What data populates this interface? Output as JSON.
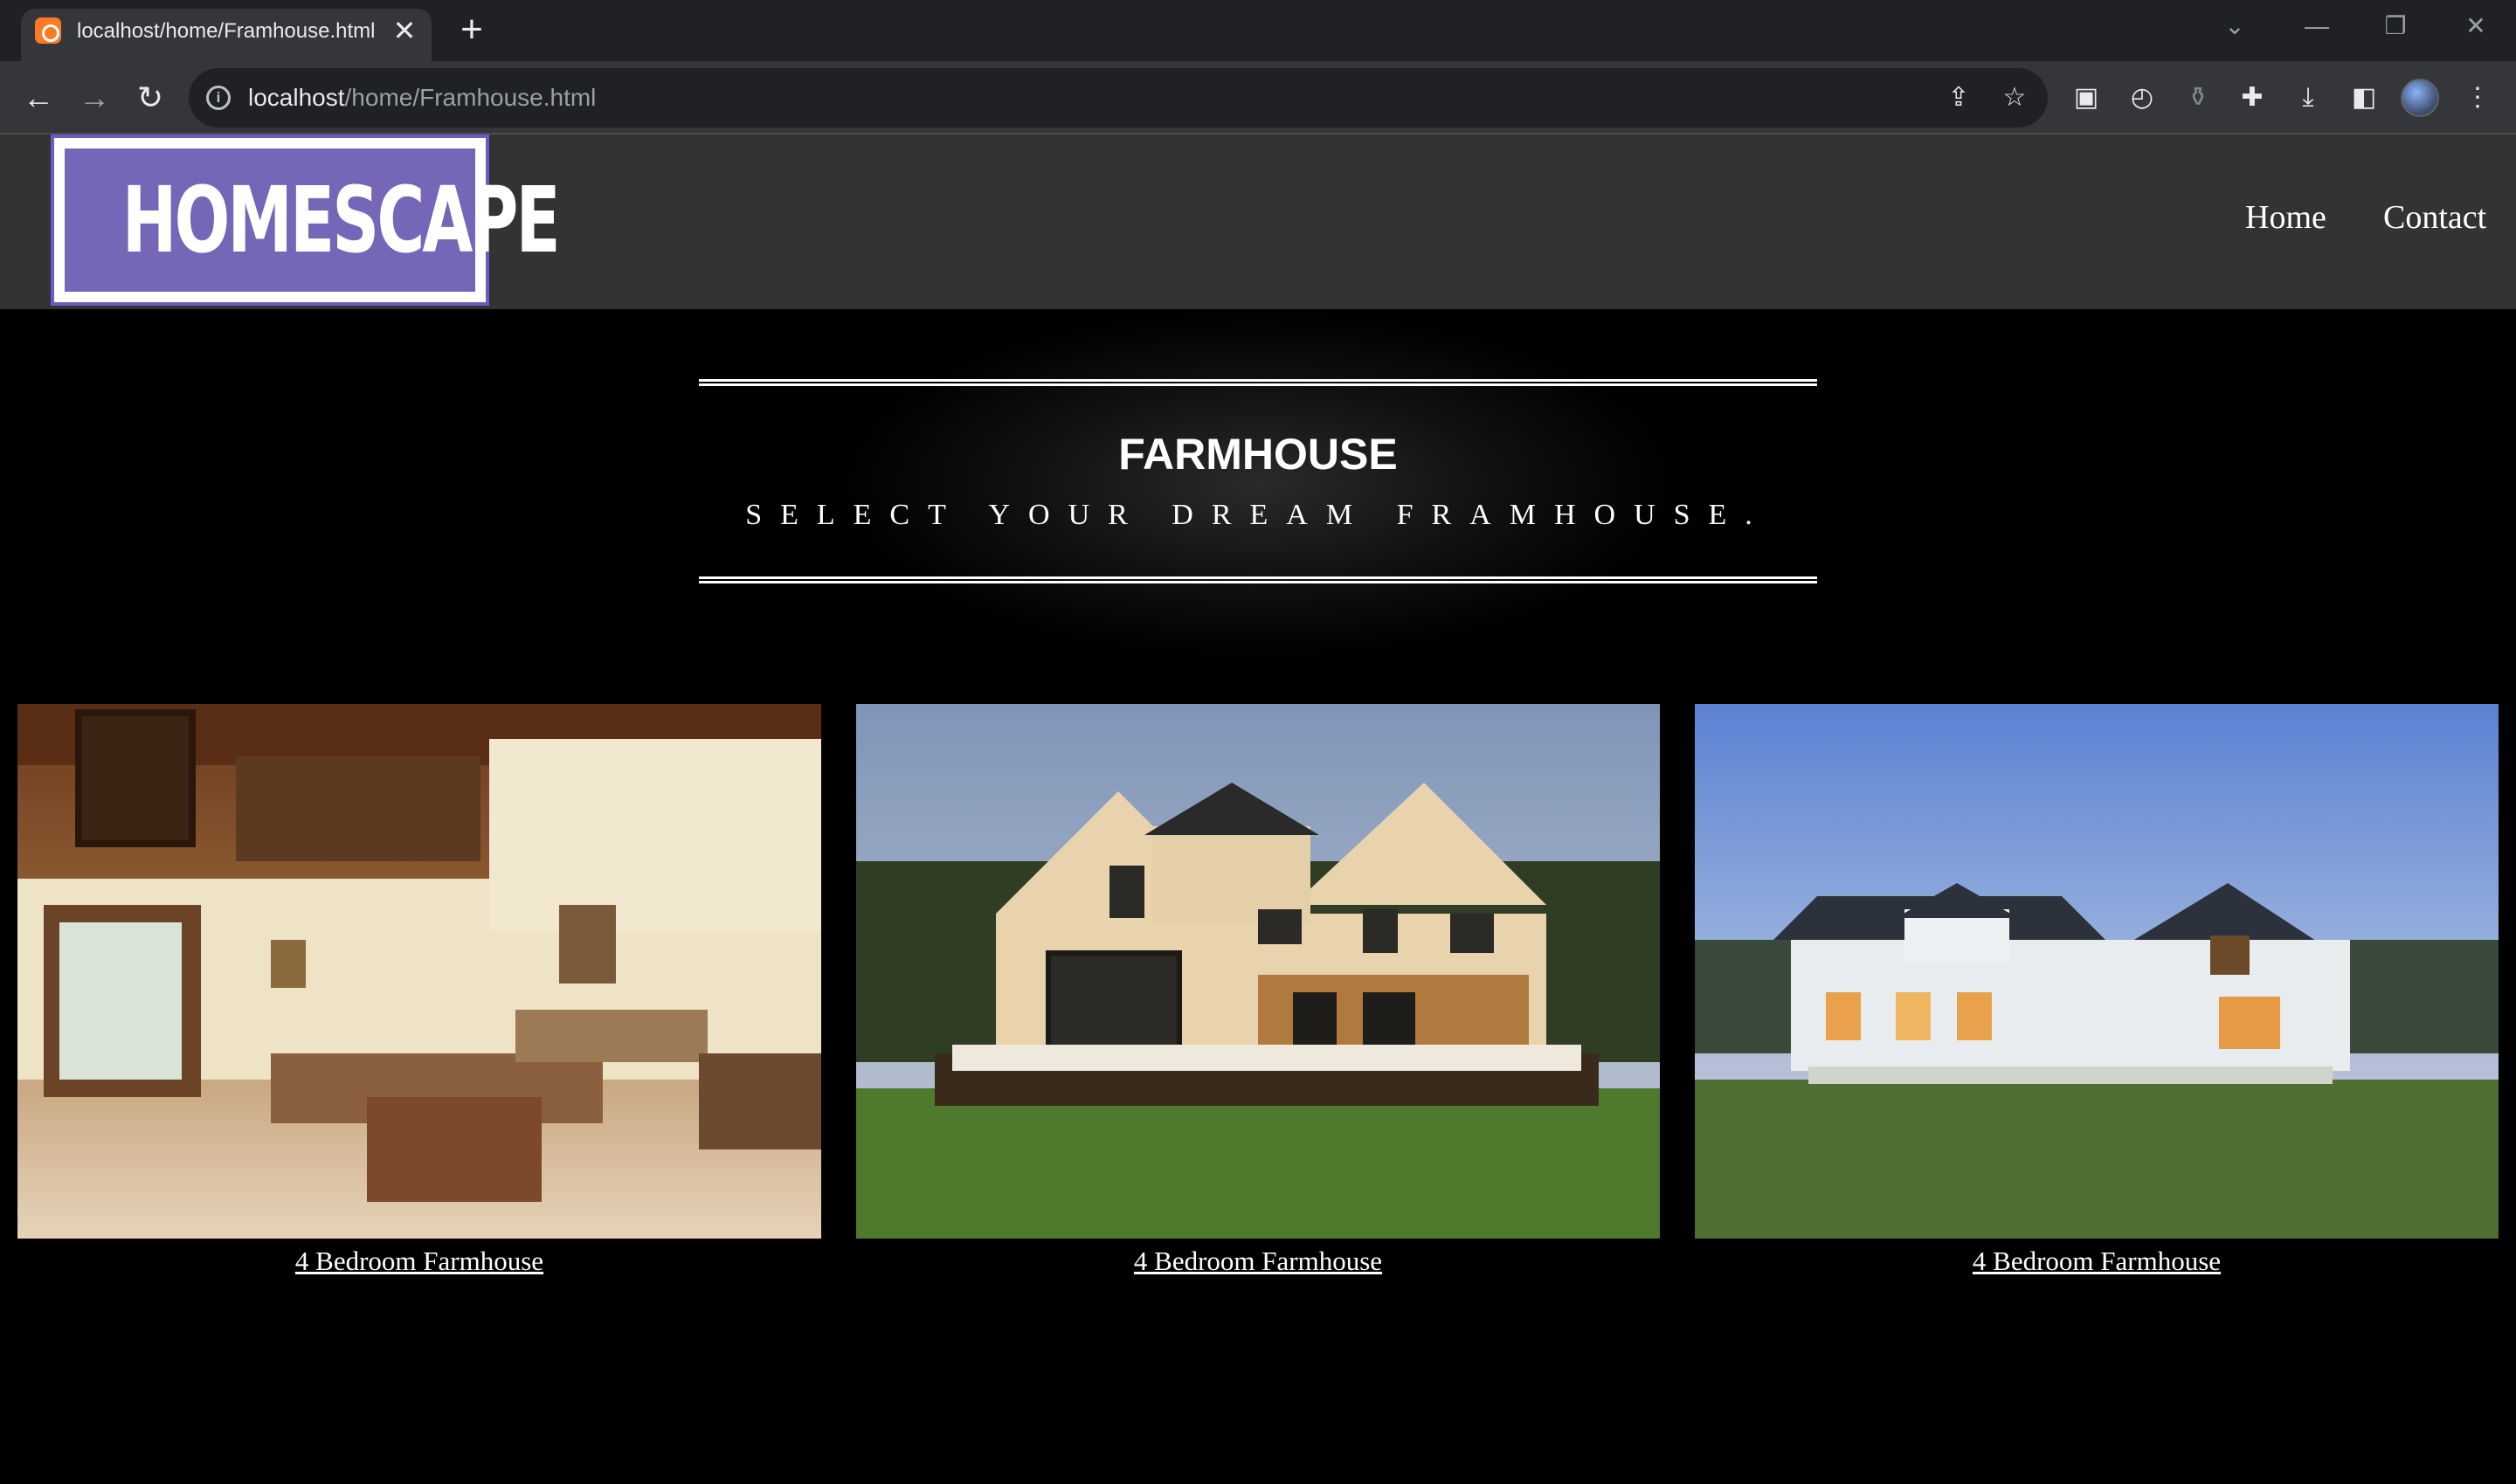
{
  "browser": {
    "tab_title": "localhost/home/Framhouse.html",
    "tab_close": "✕",
    "new_tab": "+",
    "url_host": "localhost",
    "url_path": "/home/Framhouse.html",
    "back": "←",
    "forward": "→",
    "reload": "↻",
    "window": {
      "tab_search": "⌄",
      "minimize": "—",
      "restore": "❐",
      "close": "✕"
    },
    "icons": {
      "info": "i",
      "share": "⇪",
      "star": "☆",
      "extension_screenshot": "▣",
      "extension_speed": "◴",
      "extension_bottle": "⚱",
      "extensions_puzzle": "✚",
      "download": "⤓",
      "side_panel": "◧",
      "menu": "⋮"
    }
  },
  "header": {
    "logo_text": "HOMESCAPE",
    "nav": {
      "home": "Home",
      "contact": "Contact"
    }
  },
  "hero": {
    "title": "FARMHOUSE",
    "subtitle": "SELECT YOUR DREAM FRAMHOUSE."
  },
  "cards": [
    {
      "label": "4 Bedroom Farmhouse"
    },
    {
      "label": "4 Bedroom Farmhouse"
    },
    {
      "label": "4 Bedroom Farmhouse"
    }
  ],
  "colors": {
    "header_bg": "#333333",
    "logo_purple": "#7566b8",
    "page_bg": "#000000",
    "chrome_dark": "#202124",
    "chrome_toolbar": "#35363a"
  }
}
